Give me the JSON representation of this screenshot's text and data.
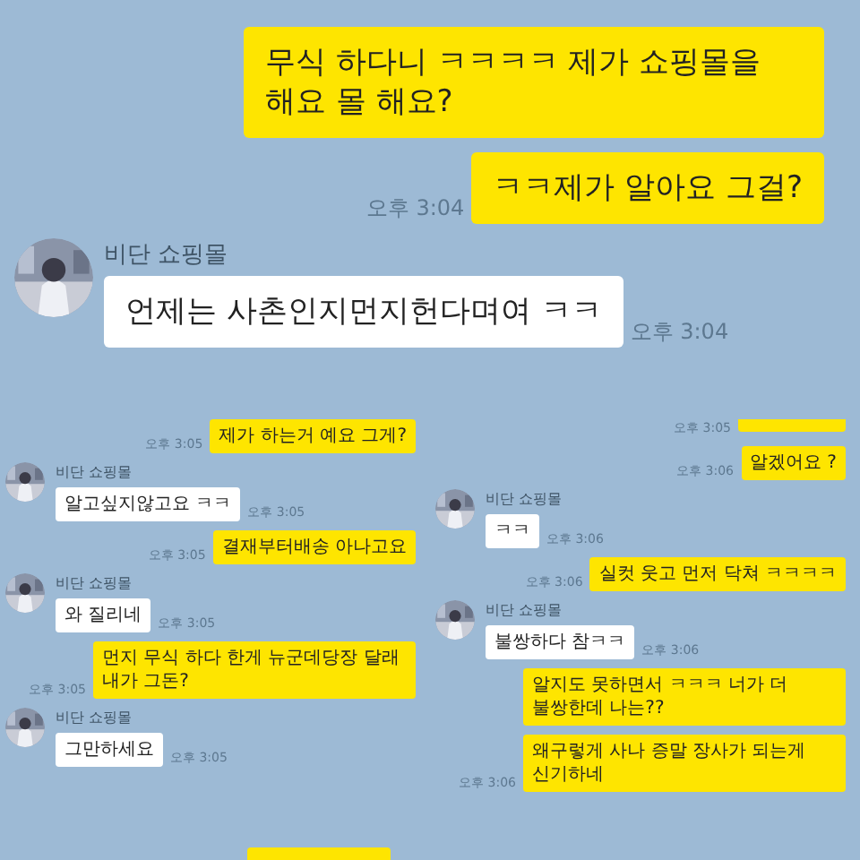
{
  "panels": [
    {
      "messages": [
        {
          "kind": "sent",
          "text": "무식 하다니 ㅋㅋㅋㅋ 제가 쇼핑몰을 해요 몰 해요?"
        },
        {
          "kind": "sent",
          "text": "ㅋㅋ제가 알아요 그걸?",
          "time": "오후 3:04"
        },
        {
          "kind": "received",
          "sender": "비단 쇼핑몰",
          "text": "언제는 사촌인지먼지헌다며여 ㅋㅋ",
          "time": "오후 3:04"
        }
      ]
    },
    {
      "messages": [
        {
          "kind": "sent",
          "text": "제가 하는거 예요 그게?",
          "time": "오후 3:05"
        },
        {
          "kind": "received",
          "sender": "비단 쇼핑몰",
          "text": "알고싶지않고요 ㅋㅋ",
          "time": "오후 3:05"
        },
        {
          "kind": "sent",
          "text": "결재부터배송 아나고요",
          "time": "오후 3:05"
        },
        {
          "kind": "received",
          "sender": "비단 쇼핑몰",
          "text": "와 질리네",
          "time": "오후 3:05"
        },
        {
          "kind": "sent",
          "text": "먼지 무식 하다 한게 뉴군데당장 달래 내가 그돈?",
          "time": "오후 3:05"
        },
        {
          "kind": "received",
          "sender": "비단 쇼핑몰",
          "text": "그만하세요",
          "time": "오후 3:05"
        },
        {
          "kind": "cut"
        }
      ]
    },
    {
      "messages": [
        {
          "kind": "cut",
          "time": "오후 3:05"
        },
        {
          "kind": "sent",
          "text": "알겠어요 ?",
          "time": "오후 3:06"
        },
        {
          "kind": "received",
          "sender": "비단 쇼핑몰",
          "text": "ㅋㅋ",
          "time": "오후 3:06"
        },
        {
          "kind": "sent",
          "text": "실컷 웃고 먼저 닥쳐 ㅋㅋㅋㅋ",
          "time": "오후 3:06"
        },
        {
          "kind": "received",
          "sender": "비단 쇼핑몰",
          "text": "불쌍하다 참ㅋㅋ",
          "time": "오후 3:06"
        },
        {
          "kind": "sent",
          "text": "알지도 못하면서 ㅋㅋㅋ 너가 더 불쌍한데 나는??"
        },
        {
          "kind": "sent",
          "text": "왜구렇게 사나 증말 장사가 되는게 신기하네",
          "time": "오후 3:06"
        }
      ]
    }
  ]
}
